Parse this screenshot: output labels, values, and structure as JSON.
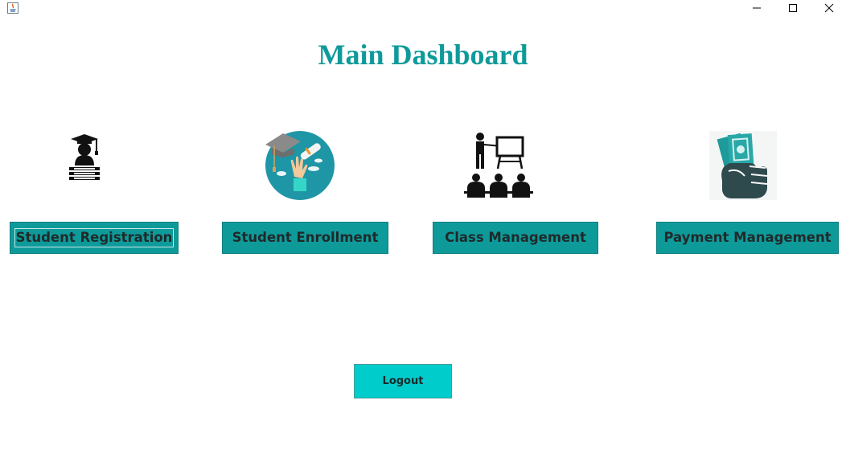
{
  "window": {
    "controls": {
      "minimize": "minimize-icon",
      "maximize": "maximize-icon",
      "close": "close-icon"
    }
  },
  "page": {
    "title": "Main Dashboard"
  },
  "modules": [
    {
      "label": "Student Registration",
      "icon": "graduate-student-icon"
    },
    {
      "label": "Student Enrollment",
      "icon": "graduation-certificate-icon"
    },
    {
      "label": "Class Management",
      "icon": "classroom-teacher-icon"
    },
    {
      "label": "Payment Management",
      "icon": "cash-in-hand-icon"
    }
  ],
  "logout": {
    "label": "Logout"
  },
  "colors": {
    "accent": "#0f9a9a",
    "logout": "#00cccc",
    "title": "#0f9a9a"
  }
}
